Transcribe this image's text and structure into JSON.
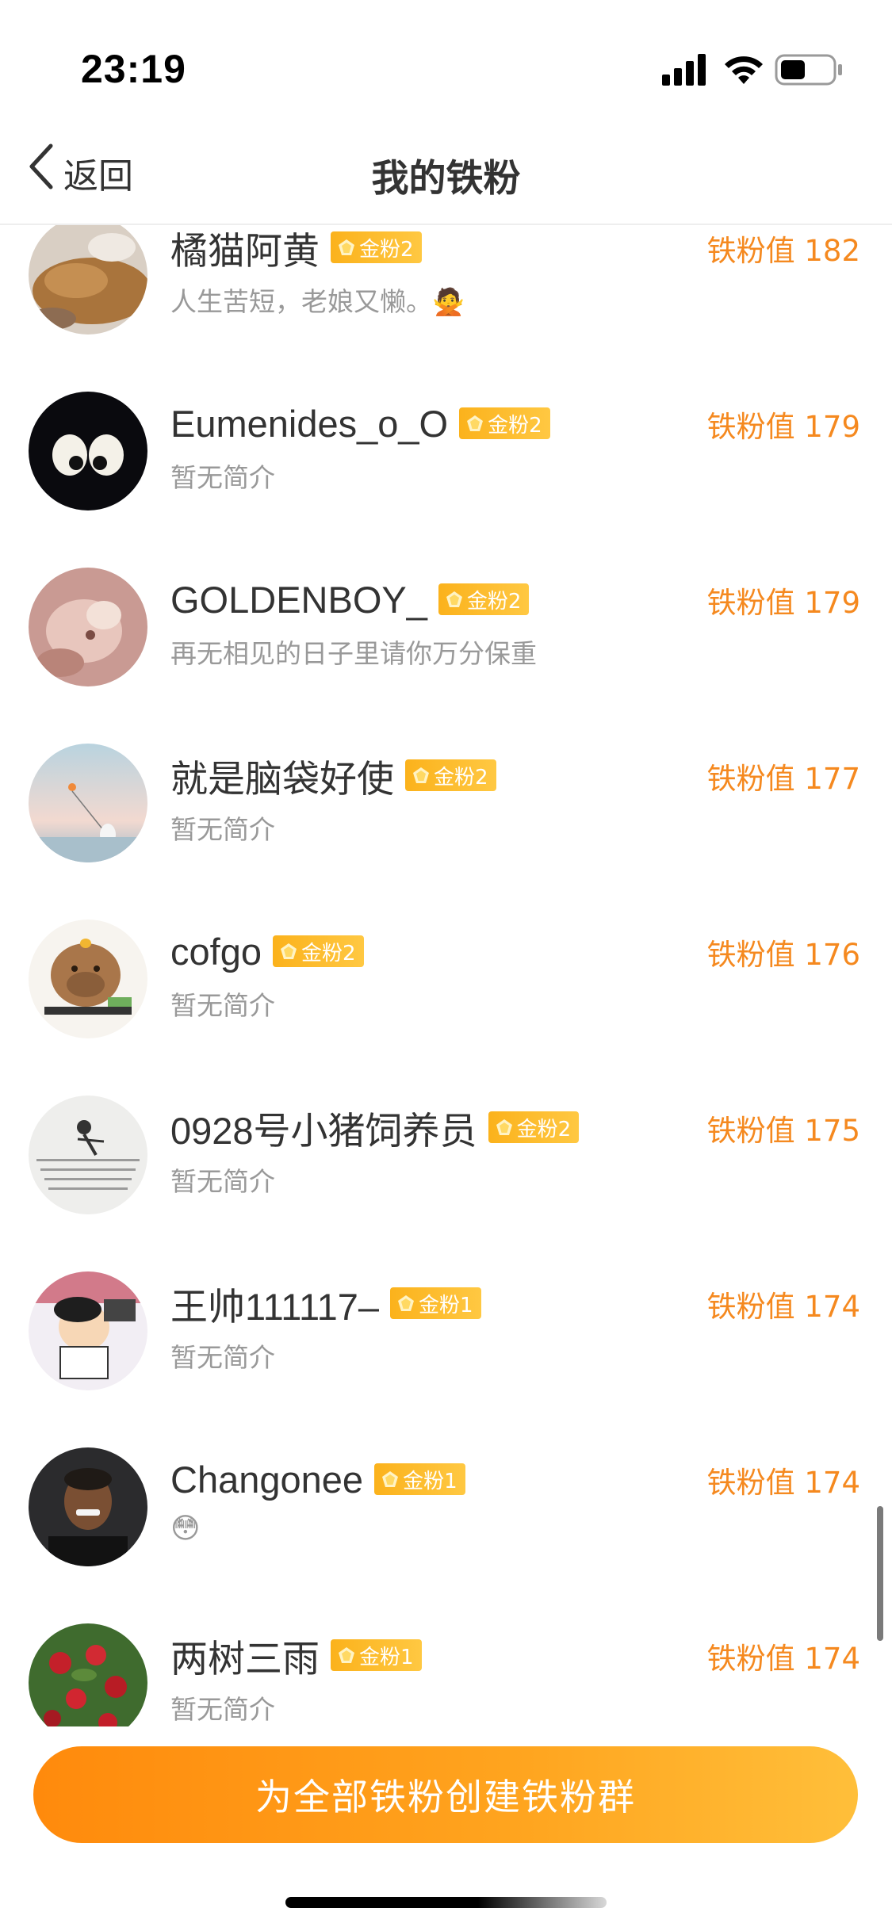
{
  "status_bar": {
    "time": "23:19",
    "icons": [
      "cellular-signal-icon",
      "wifi-icon",
      "battery-icon"
    ]
  },
  "nav": {
    "back_label": "返回",
    "title": "我的铁粉"
  },
  "colors": {
    "accent_orange": "#f5891f",
    "badge_gold": "#fbb21c",
    "button_gradient_start": "#ff8a0c",
    "button_gradient_end": "#ffbf3a",
    "text_primary": "#333333",
    "text_secondary": "#999999"
  },
  "fans": [
    {
      "name": "橘猫阿黄",
      "badge": "金粉2",
      "bio": "人生苦短，老娘又懒。🙅",
      "score": "铁粉值 182"
    },
    {
      "name": "Eumenides_o_O",
      "badge": "金粉2",
      "bio": "暂无简介",
      "score": "铁粉值 179"
    },
    {
      "name": "GOLDENBOY_",
      "badge": "金粉2",
      "bio": "再无相见的日子里请你万分保重",
      "score": "铁粉值 179"
    },
    {
      "name": "就是脑袋好使",
      "badge": "金粉2",
      "bio": "暂无简介",
      "score": "铁粉值 177"
    },
    {
      "name": "cofgo",
      "badge": "金粉2",
      "bio": "暂无简介",
      "score": "铁粉值 176"
    },
    {
      "name": "0928号小猪饲养员",
      "badge": "金粉2",
      "bio": "暂无简介",
      "score": "铁粉值 175"
    },
    {
      "name": "王帅111117–",
      "badge": "金粉1",
      "bio": "暂无简介",
      "score": "铁粉值 174"
    },
    {
      "name": "Changonee",
      "badge": "金粉1",
      "bio": "😳",
      "score": "铁粉值 174"
    },
    {
      "name": "两树三雨",
      "badge": "金粉1",
      "bio": "暂无简介",
      "score": "铁粉值 174"
    }
  ],
  "bottom": {
    "create_group_label": "为全部铁粉创建铁粉群"
  }
}
